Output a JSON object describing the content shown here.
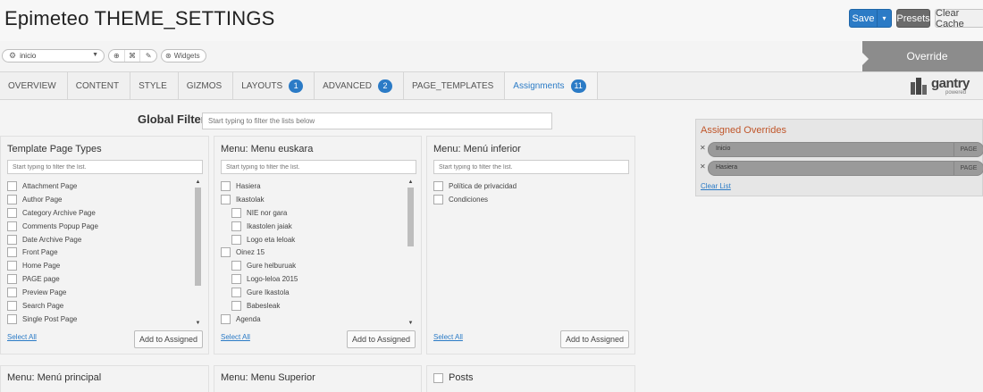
{
  "header": {
    "title": "Epimeteo THEME_SETTINGS",
    "save": "Save",
    "save_dropdown": "▾",
    "presets": "Presets",
    "clear_cache": "Clear Cache"
  },
  "toolbar": {
    "selected_override": "inicio",
    "tool_icons": [
      "circle-plus-icon",
      "copy-icon",
      "pencil-icon"
    ],
    "widgets_label": "Widgets",
    "override_label": "Override"
  },
  "tabs": [
    {
      "label": "OVERVIEW",
      "badge": null,
      "active": false
    },
    {
      "label": "CONTENT",
      "badge": null,
      "active": false
    },
    {
      "label": "STYLE",
      "badge": null,
      "active": false
    },
    {
      "label": "GIZMOS",
      "badge": null,
      "active": false
    },
    {
      "label": "LAYOUTS",
      "badge": "1",
      "active": false
    },
    {
      "label": "ADVANCED",
      "badge": "2",
      "active": false
    },
    {
      "label": "PAGE_TEMPLATES",
      "badge": null,
      "active": false
    },
    {
      "label": "Assignments",
      "badge": "11",
      "active": true
    }
  ],
  "logo": {
    "word": "gantry",
    "sub": "powered"
  },
  "global_filter": {
    "label": "Global Filter",
    "placeholder": "Start typing to filter the lists below"
  },
  "panels": {
    "template_page_types": {
      "title": "Template Page Types",
      "placeholder": "Start typing to filter the list.",
      "items": [
        {
          "label": "Attachment Page",
          "level": 0
        },
        {
          "label": "Author Page",
          "level": 0
        },
        {
          "label": "Category Archive Page",
          "level": 0
        },
        {
          "label": "Comments Popup Page",
          "level": 0
        },
        {
          "label": "Date Archive Page",
          "level": 0
        },
        {
          "label": "Front Page",
          "level": 0
        },
        {
          "label": "Home Page",
          "level": 0
        },
        {
          "label": "PAGE page",
          "level": 0
        },
        {
          "label": "Preview Page",
          "level": 0
        },
        {
          "label": "Search Page",
          "level": 0
        },
        {
          "label": "Single Post Page",
          "level": 0
        }
      ],
      "select_all": "Select All",
      "add_button": "Add to Assigned"
    },
    "menu_euskara": {
      "title": "Menu: Menu euskara",
      "placeholder": "Start typing to filter the list.",
      "items": [
        {
          "label": "Hasiera",
          "level": 0
        },
        {
          "label": "Ikastolak",
          "level": 0
        },
        {
          "label": "NIE nor gara",
          "level": 1
        },
        {
          "label": "Ikastolen jaiak",
          "level": 1
        },
        {
          "label": "Logo eta leloak",
          "level": 1
        },
        {
          "label": "Oinez 15",
          "level": 0
        },
        {
          "label": "Gure helburuak",
          "level": 1
        },
        {
          "label": "Logo-leloa 2015",
          "level": 1
        },
        {
          "label": "Gure Ikastola",
          "level": 1
        },
        {
          "label": "Babesleak",
          "level": 1
        },
        {
          "label": "Agenda",
          "level": 0
        }
      ],
      "select_all": "Select All",
      "add_button": "Add to Assigned"
    },
    "menu_inferior": {
      "title": "Menu: Menú inferior",
      "placeholder": "Start typing to filter the list.",
      "items": [
        {
          "label": "Política de privacidad",
          "level": 0
        },
        {
          "label": "Condiciones",
          "level": 0
        }
      ],
      "select_all": "Select All",
      "add_button": "Add to Assigned"
    },
    "menu_principal": {
      "title": "Menu: Menú principal"
    },
    "menu_superior": {
      "title": "Menu: Menu Superior"
    },
    "posts": {
      "title": "Posts"
    }
  },
  "assigned_overrides": {
    "title": "Assigned Overrides",
    "items": [
      {
        "name": "Inicio",
        "type": "PAGE"
      },
      {
        "name": "Hasiera",
        "type": "PAGE"
      }
    ],
    "clear_list": "Clear List"
  },
  "colors": {
    "accent": "#2b7bc6",
    "assigned_title": "#c0562a",
    "override_bg": "#8c8c8c"
  }
}
